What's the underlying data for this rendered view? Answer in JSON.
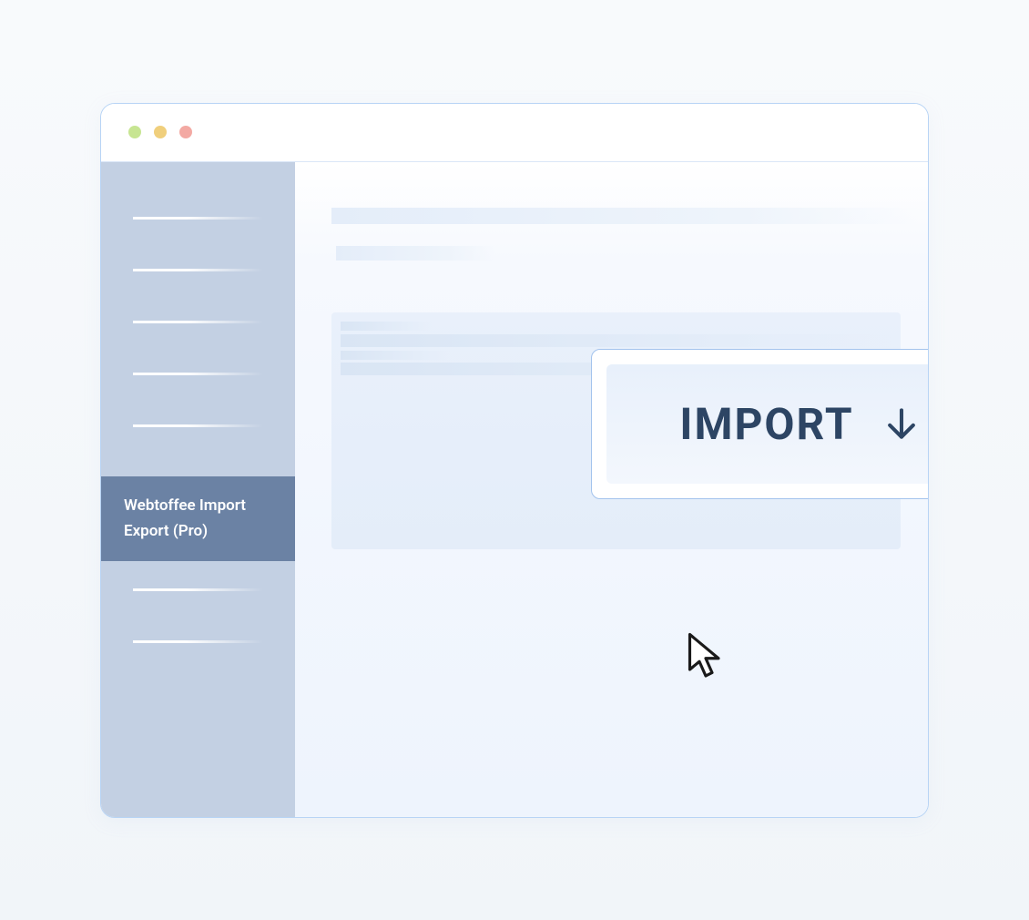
{
  "sidebar": {
    "active_item_label": "Webtoffee Import Export (Pro)"
  },
  "main": {
    "import_button_label": "IMPORT"
  },
  "colors": {
    "sidebar_bg": "#c3d0e3",
    "sidebar_active_bg": "#6b82a4",
    "border": "#b8d4f5",
    "import_text": "#2d4564"
  }
}
